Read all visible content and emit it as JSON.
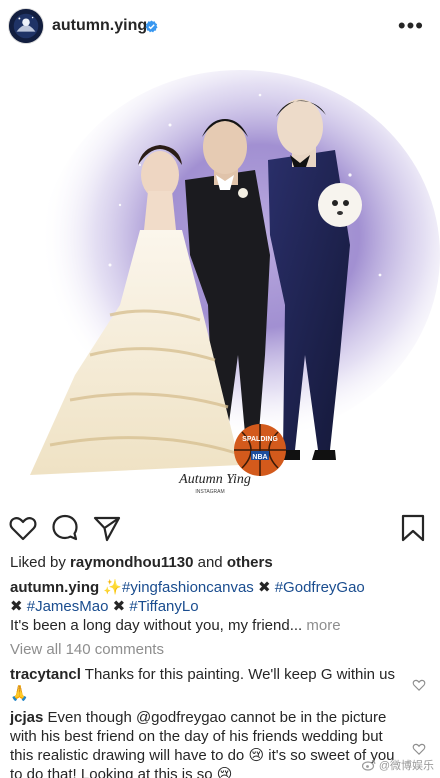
{
  "post": {
    "username": "autumn.ying",
    "more_icon": "more-horizontal-icon",
    "image_signature": "Autumn Ying",
    "image_signature_sub": "INSTAGRAM",
    "ball_text_1": "SPALDING",
    "ball_text_2": "NBA"
  },
  "actions": {
    "like_icon": "heart-outline-icon",
    "comment_icon": "comment-bubble-icon",
    "share_icon": "paper-plane-icon",
    "save_icon": "bookmark-icon"
  },
  "likes": {
    "prefix": "Liked by",
    "user": "raymondhou1130",
    "joiner": "and",
    "others": "others"
  },
  "caption": {
    "username": "autumn.ying",
    "sparkle": "✨",
    "tag1": "#yingfashioncanvas",
    "x1": "✖",
    "tag2": "#GodfreyGao",
    "x2": "✖",
    "tag3": "#JamesMao",
    "x3": "✖",
    "tag4": "#TiffanyLo",
    "text": "It's been a long day without you, my friend...",
    "more": "more"
  },
  "view_all_comments": "View all 140 comments",
  "comments": [
    {
      "username": "tracytancl",
      "text": "Thanks for this painting. We'll keep G within us",
      "emoji": "🙏"
    },
    {
      "username": "jcjas",
      "text_a": "Even though @godfreygao cannot be in the picture with his best friend on the day of his friends wedding but this realistic drawing will have to do",
      "emoji": "😢",
      "text_b": "it's so sweet of you to do that! Looking at this is so",
      "emoji2": "😢"
    }
  ],
  "watermark": "@微博娱乐",
  "colors": {
    "text": "#262626",
    "muted": "#8e8e8e",
    "verified": "#3897f0",
    "hashtag": "#1a4d8f"
  }
}
